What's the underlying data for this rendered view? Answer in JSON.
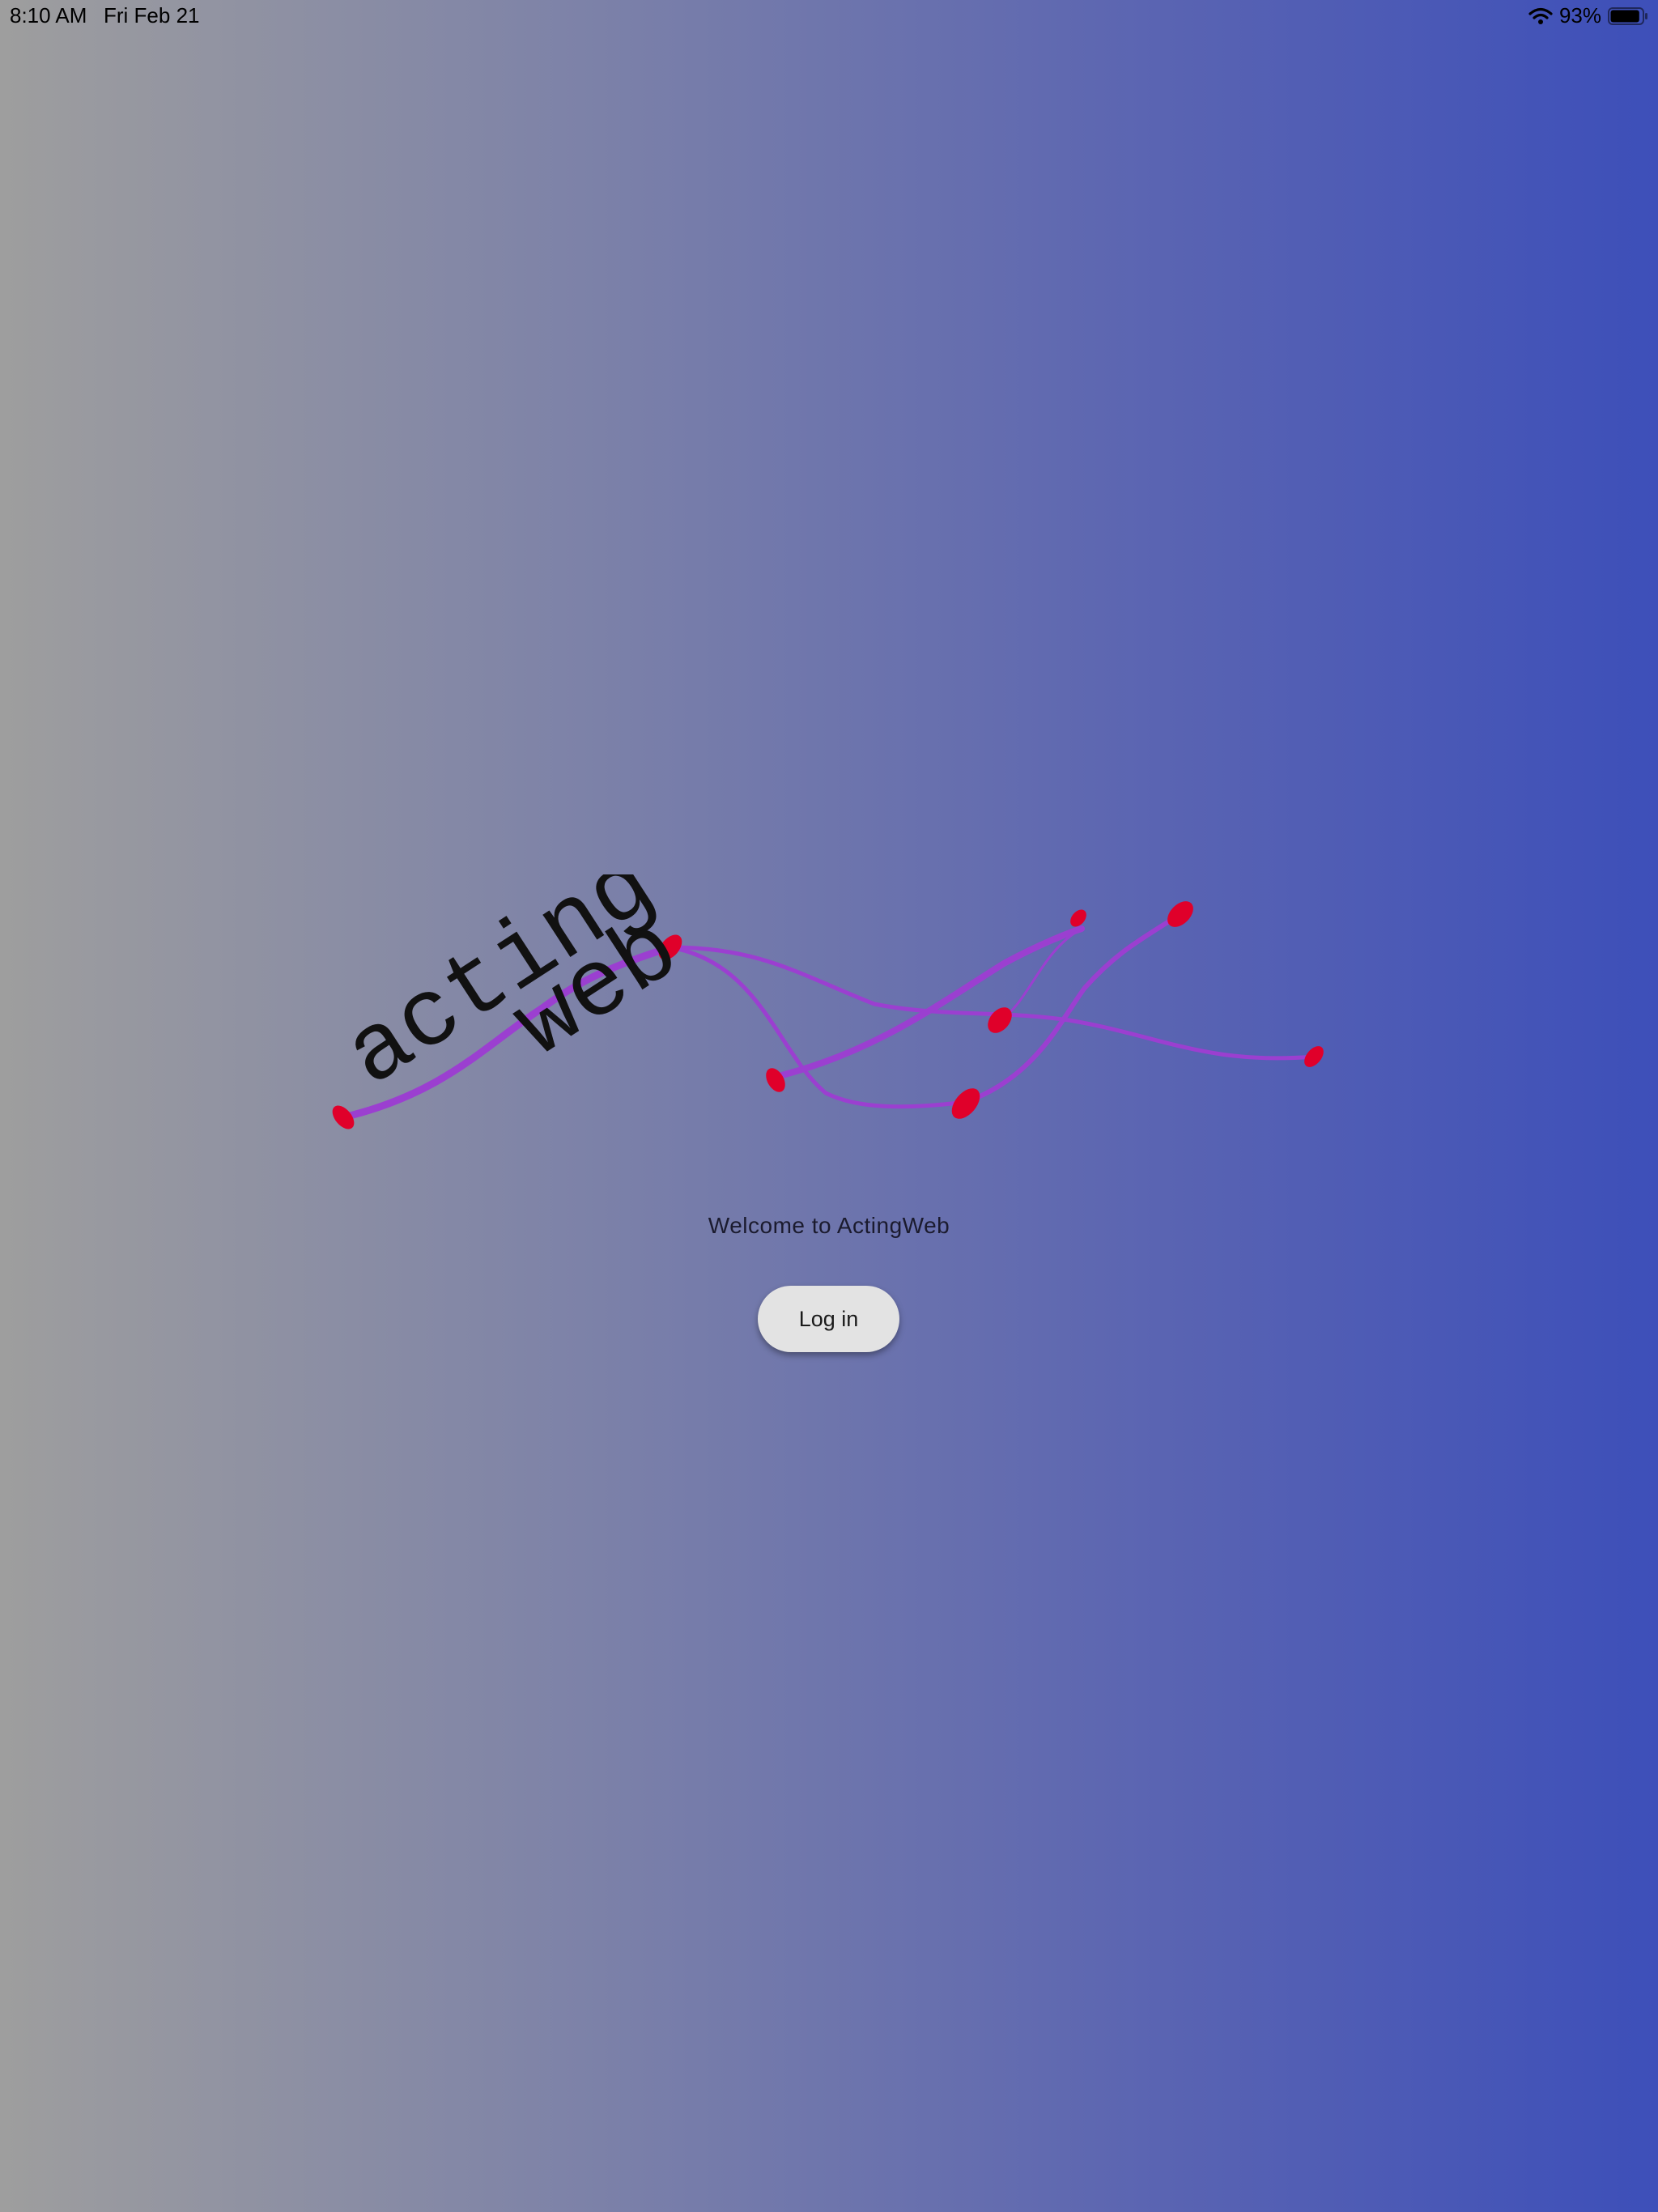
{
  "status_bar": {
    "time": "8:10 AM",
    "date": "Fri Feb 21",
    "battery": "93%",
    "battery_level": 0.93
  },
  "logo": {
    "word1": "acting",
    "word2": "web",
    "strand_color": "#9b3fd0",
    "node_color": "#e0002a"
  },
  "welcome_text": "Welcome to ActingWeb",
  "login_label": "Log in"
}
